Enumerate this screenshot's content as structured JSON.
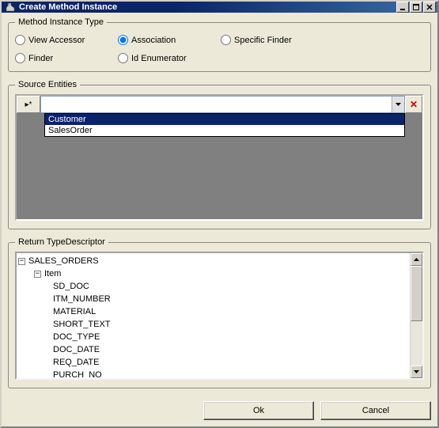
{
  "window": {
    "title": "Create Method Instance"
  },
  "method_type": {
    "legend": "Method Instance Type",
    "options": {
      "view_accessor": "View Accessor",
      "association": "Association",
      "specific_finder": "Specific Finder",
      "finder": "Finder",
      "id_enumerator": "Id Enumerator"
    },
    "selected": "association"
  },
  "source_entities": {
    "legend": "Source Entities",
    "row_marker": "▸*",
    "dropdown_items": [
      "Customer",
      "SalesOrder"
    ],
    "selected_index": 0
  },
  "return_type": {
    "legend": "Return TypeDescriptor",
    "tree": {
      "root": "SALES_ORDERS",
      "child": "Item",
      "leaves": [
        "SD_DOC",
        "ITM_NUMBER",
        "MATERIAL",
        "SHORT_TEXT",
        "DOC_TYPE",
        "DOC_DATE",
        "REQ_DATE",
        "PURCH_NO"
      ]
    }
  },
  "buttons": {
    "ok": "Ok",
    "cancel": "Cancel"
  }
}
